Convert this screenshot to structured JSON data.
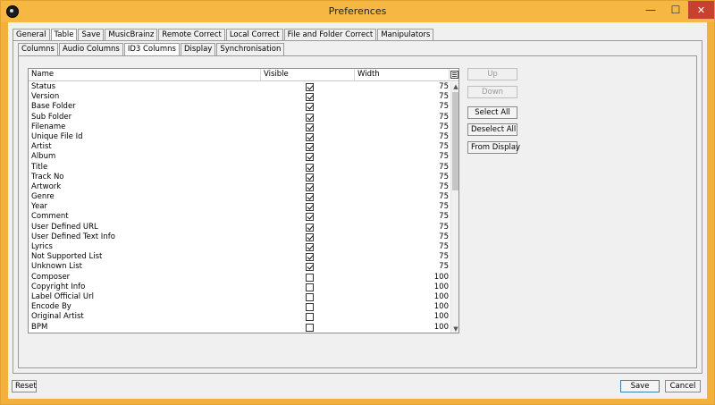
{
  "window": {
    "title": "Preferences",
    "controls": {
      "minimize": "—",
      "maximize": "☐",
      "close": "✕"
    }
  },
  "main_tabs": [
    {
      "label": "General",
      "active": false
    },
    {
      "label": "Table",
      "active": true
    },
    {
      "label": "Save",
      "active": false
    },
    {
      "label": "MusicBrainz",
      "active": false
    },
    {
      "label": "Remote Correct",
      "active": false
    },
    {
      "label": "Local Correct",
      "active": false
    },
    {
      "label": "File and Folder Correct",
      "active": false
    },
    {
      "label": "Manipulators",
      "active": false
    }
  ],
  "sub_tabs": [
    {
      "label": "Columns",
      "active": false
    },
    {
      "label": "Audio Columns",
      "active": false
    },
    {
      "label": "ID3 Columns",
      "active": true
    },
    {
      "label": "Display",
      "active": false
    },
    {
      "label": "Synchronisation",
      "active": false
    }
  ],
  "table": {
    "headers": {
      "name": "Name",
      "visible": "Visible",
      "width": "Width"
    },
    "config_icon": "column-chooser-icon",
    "rows": [
      {
        "name": "Status",
        "visible": true,
        "width": "75"
      },
      {
        "name": "Version",
        "visible": true,
        "width": "75"
      },
      {
        "name": "Base Folder",
        "visible": true,
        "width": "75"
      },
      {
        "name": "Sub Folder",
        "visible": true,
        "width": "75"
      },
      {
        "name": "Filename",
        "visible": true,
        "width": "75"
      },
      {
        "name": "Unique File Id",
        "visible": true,
        "width": "75"
      },
      {
        "name": "Artist",
        "visible": true,
        "width": "75"
      },
      {
        "name": "Album",
        "visible": true,
        "width": "75"
      },
      {
        "name": "Title",
        "visible": true,
        "width": "75"
      },
      {
        "name": "Track No",
        "visible": true,
        "width": "75"
      },
      {
        "name": "Artwork",
        "visible": true,
        "width": "75"
      },
      {
        "name": "Genre",
        "visible": true,
        "width": "75"
      },
      {
        "name": "Year",
        "visible": true,
        "width": "75"
      },
      {
        "name": "Comment",
        "visible": true,
        "width": "75"
      },
      {
        "name": "User Defined URL",
        "visible": true,
        "width": "75"
      },
      {
        "name": "User Defined Text Info",
        "visible": true,
        "width": "75"
      },
      {
        "name": "Lyrics",
        "visible": true,
        "width": "75"
      },
      {
        "name": "Not Supported List",
        "visible": true,
        "width": "75"
      },
      {
        "name": "Unknown List",
        "visible": true,
        "width": "75"
      },
      {
        "name": "Composer",
        "visible": false,
        "width": "100"
      },
      {
        "name": "Copyright Info",
        "visible": false,
        "width": "100"
      },
      {
        "name": "Label Official Url",
        "visible": false,
        "width": "100"
      },
      {
        "name": "Encode By",
        "visible": false,
        "width": "100"
      },
      {
        "name": "Original Artist",
        "visible": false,
        "width": "100"
      },
      {
        "name": "BPM",
        "visible": false,
        "width": "100"
      }
    ]
  },
  "side_buttons": {
    "up": "Up",
    "down": "Down",
    "select_all": "Select All",
    "deselect_all": "Deselect All",
    "from_display": "From Display"
  },
  "bottom_buttons": {
    "reset": "Reset",
    "save": "Save",
    "cancel": "Cancel"
  }
}
